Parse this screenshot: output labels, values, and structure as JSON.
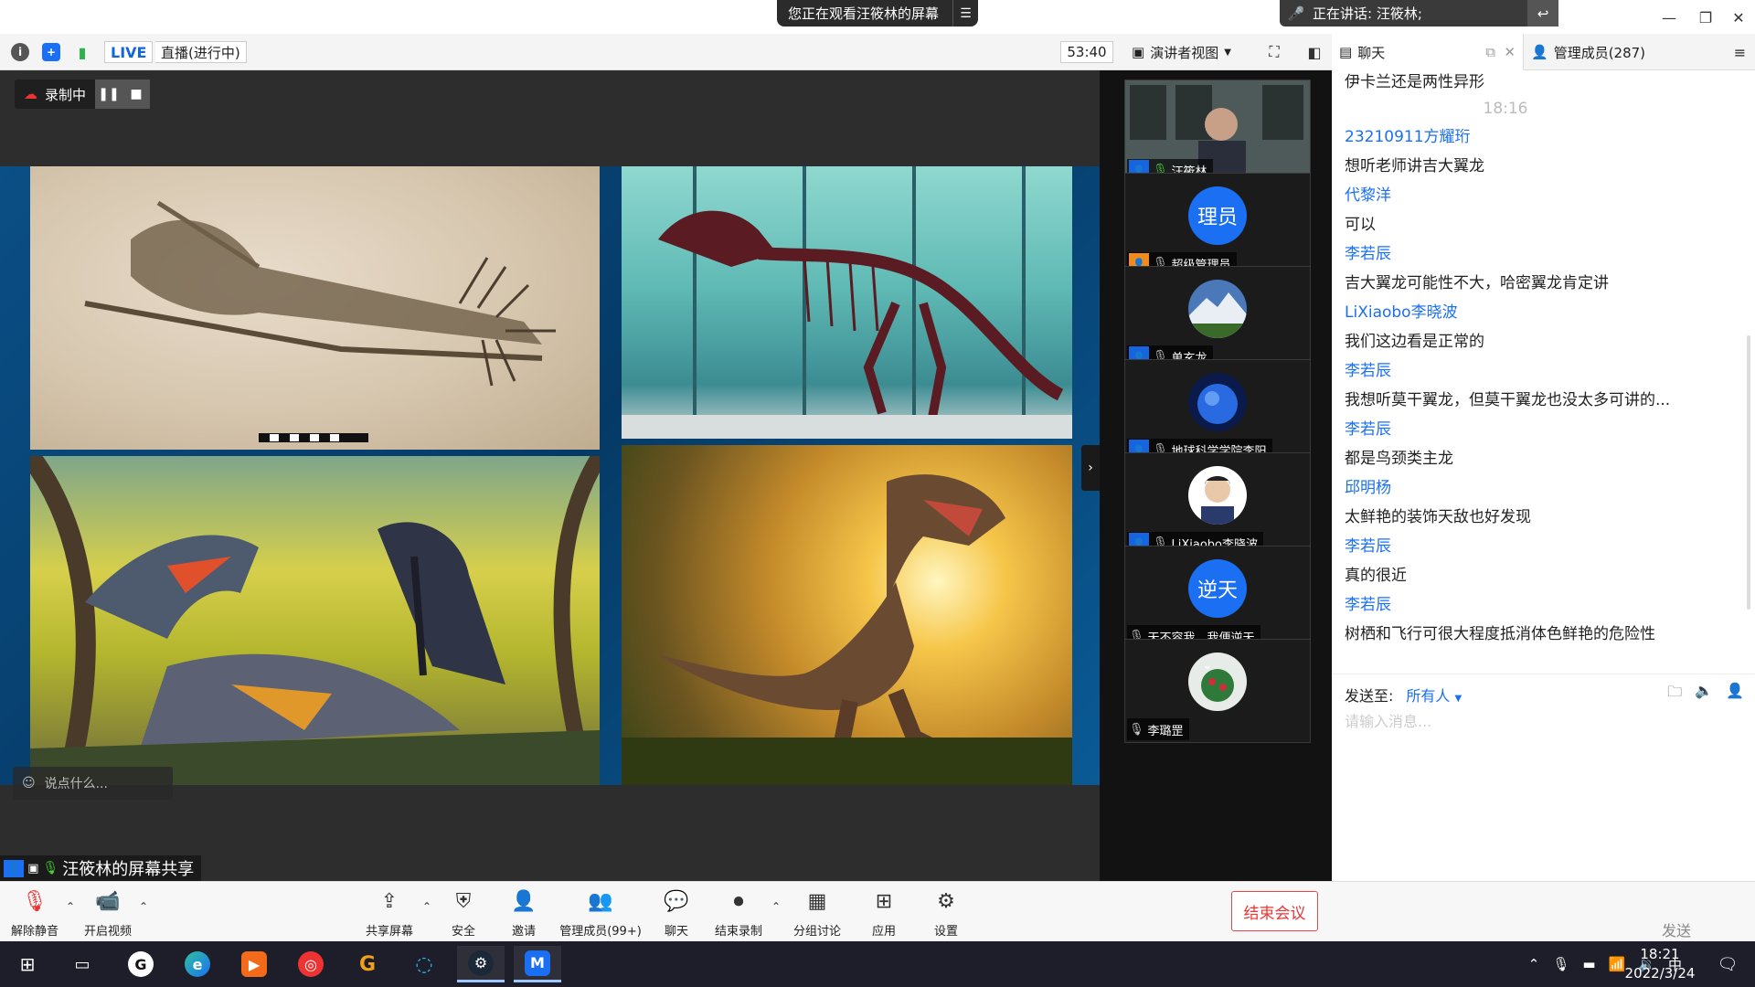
{
  "title_bar": {
    "share_notice": "您正在观看汪筱林的屏幕",
    "share_menu_icon": "menu-icon",
    "speaking": "正在讲话: 汪筱林;",
    "window_controls": [
      "minimize-icon",
      "restore-icon",
      "close-icon"
    ]
  },
  "meeting_bar": {
    "live_badge": "LIVE",
    "live_status": "直播(进行中)",
    "timer": "53:40",
    "view_mode": "演讲者视图"
  },
  "recording": {
    "label": "录制中"
  },
  "danmu_placeholder": "说点什么...",
  "share_label": "汪筱林的屏幕共享",
  "participants": [
    {
      "name": "汪筱林",
      "mic": "on",
      "role": "user",
      "avatar": "video"
    },
    {
      "name": "超级管理员",
      "mic": "muted",
      "role": "admin",
      "avatar_text": "理员"
    },
    {
      "name": "单玄龙",
      "mic": "muted",
      "role": "user",
      "avatar": "photo-mountain"
    },
    {
      "name": "地球科学学院李阳",
      "mic": "muted",
      "role": "user",
      "avatar": "photo-earth"
    },
    {
      "name": "LiXiaobo李晓波",
      "mic": "muted",
      "role": "user",
      "avatar": "photo-person"
    },
    {
      "name": "天不容我，我便逆天",
      "mic": "muted",
      "role": "none",
      "avatar_text": "逆天"
    },
    {
      "name": "李璐罡",
      "mic": "muted",
      "role": "none",
      "avatar": "photo-flower"
    }
  ],
  "panel_tabs": {
    "chat": "聊天",
    "members": "管理成员(287)"
  },
  "chat": {
    "messages": [
      {
        "kind": "text",
        "text": "伊卡兰还是两性异形"
      },
      {
        "kind": "time",
        "text": "18:16"
      },
      {
        "kind": "name",
        "text": "23210911方耀珩"
      },
      {
        "kind": "text",
        "text": "想听老师讲吉大翼龙"
      },
      {
        "kind": "name",
        "text": "代黎洋"
      },
      {
        "kind": "text",
        "text": "可以"
      },
      {
        "kind": "name",
        "text": "李若辰"
      },
      {
        "kind": "text",
        "text": "吉大翼龙可能性不大，哈密翼龙肯定讲"
      },
      {
        "kind": "name",
        "text": "LiXiaobo李晓波"
      },
      {
        "kind": "text",
        "text": "我们这边看是正常的"
      },
      {
        "kind": "name",
        "text": "李若辰"
      },
      {
        "kind": "text",
        "text": "我想听莫干翼龙，但莫干翼龙也没太多可讲的..."
      },
      {
        "kind": "name",
        "text": "李若辰"
      },
      {
        "kind": "text",
        "text": "都是鸟颈类主龙"
      },
      {
        "kind": "name",
        "text": "邱明杨"
      },
      {
        "kind": "text",
        "text": "太鲜艳的装饰天敌也好发现"
      },
      {
        "kind": "name",
        "text": "李若辰"
      },
      {
        "kind": "text",
        "text": "真的很近"
      },
      {
        "kind": "name",
        "text": "李若辰"
      },
      {
        "kind": "text",
        "text": "树栖和飞行可很大程度抵消体色鲜艳的危险性"
      }
    ],
    "send_to_label": "发送至:",
    "send_to_value": "所有人",
    "input_placeholder": "请输入消息...",
    "send_button": "发送(S)"
  },
  "controls": [
    {
      "label": "解除静音",
      "icon": "mic-muted-icon"
    },
    {
      "label": "开启视频",
      "icon": "video-off-icon"
    },
    {
      "label": "共享屏幕",
      "icon": "share-screen-icon"
    },
    {
      "label": "安全",
      "icon": "shield-icon"
    },
    {
      "label": "邀请",
      "icon": "invite-icon"
    },
    {
      "label": "管理成员(99+)",
      "icon": "members-icon"
    },
    {
      "label": "聊天",
      "icon": "chat-icon"
    },
    {
      "label": "结束录制",
      "icon": "stop-record-icon"
    },
    {
      "label": "分组讨论",
      "icon": "breakout-icon"
    },
    {
      "label": "应用",
      "icon": "apps-icon"
    },
    {
      "label": "设置",
      "icon": "gear-icon"
    }
  ],
  "end_meeting": "结束会议",
  "taskbar": {
    "ime": "中",
    "time": "18:21",
    "date": "2022/3/24"
  }
}
